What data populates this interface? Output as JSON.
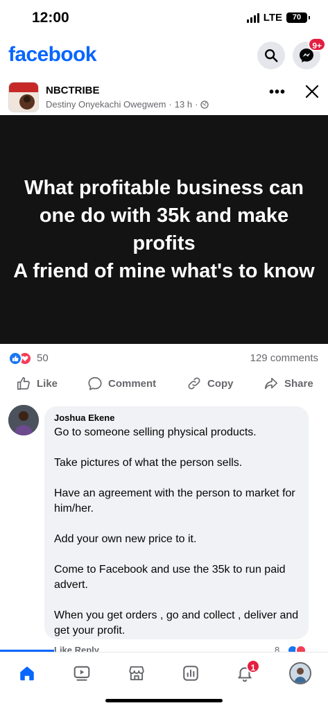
{
  "status_bar": {
    "time": "12:00",
    "network": "LTE",
    "battery": "70"
  },
  "header": {
    "logo": "facebook",
    "messenger_badge": "9+",
    "icons": [
      "search-icon",
      "messenger-icon"
    ]
  },
  "post": {
    "page_name": "NBCTRIBE",
    "author": "Destiny Onyekachi Owegwem",
    "time": "13 h",
    "separator": "·",
    "privacy_icon": "globe-icon",
    "image_text": "What profitable business can one do with 35k and make profits\nA friend of mine what's to know",
    "reaction_count": "50",
    "comment_count": "129 comments",
    "actions": {
      "like": "Like",
      "comment": "Comment",
      "copy": "Copy",
      "share": "Share"
    }
  },
  "comment": {
    "author": "Joshua Ekene",
    "paragraphs": [
      "Go to someone selling physical products.",
      "Take pictures of what the person sells.",
      "Have an agreement with the person to market for him/her.",
      "Add your own new price to it.",
      "Come to Facebook and use the 35k to run paid advert.",
      "When you get orders , go and collect , deliver and get your profit."
    ],
    "footer_actions": "Like    Reply",
    "footer_reaction_count": "8"
  },
  "bottom_nav": {
    "items": [
      "home-icon",
      "video-icon",
      "marketplace-icon",
      "dashboard-icon",
      "notifications-icon",
      "profile-avatar"
    ],
    "notifications_badge": "1"
  },
  "colors": {
    "brand": "#0866ff",
    "badge": "#e41e3f",
    "like": "#1877f2",
    "love": "#f33e58",
    "image_background": "#131313"
  }
}
